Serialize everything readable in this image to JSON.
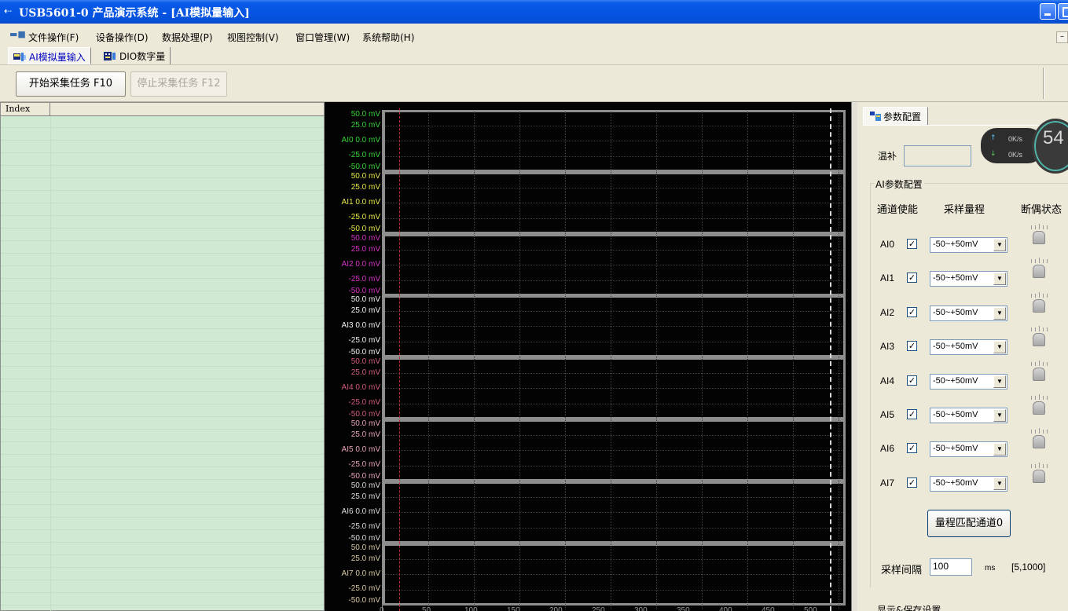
{
  "window": {
    "title": "USB5601-0 产品演示系统 - [AI模拟量输入]"
  },
  "menu": [
    "文件操作(F)",
    "设备操作(D)",
    "数据处理(P)",
    "视图控制(V)",
    "窗口管理(W)",
    "系统帮助(H)"
  ],
  "tabs": [
    {
      "label": "AI模拟量输入",
      "active": true
    },
    {
      "label": "DIO数字量",
      "active": false
    }
  ],
  "toolbar": {
    "start_label": "开始采集任务 F10",
    "stop_label": "停止采集任务 F12"
  },
  "list": {
    "header_index": "Index"
  },
  "scope": {
    "channels": [
      {
        "name": "AI0",
        "color": "#37d337",
        "top": "50.0 mV",
        "upper": "25.0 mV",
        "mid": "AI0  0.0 mV",
        "lower": "-25.0 mV",
        "bottom": "-50.0 mV"
      },
      {
        "name": "AI1",
        "color": "#e8e84a",
        "top": "50.0 mV",
        "upper": "25.0 mV",
        "mid": "AI1  0.0 mV",
        "lower": "-25.0 mV",
        "bottom": "-50.0 mV"
      },
      {
        "name": "AI2",
        "color": "#d633c8",
        "top": "50.0 mV",
        "upper": "25.0 mV",
        "mid": "AI2  0.0 mV",
        "lower": "-25.0 mV",
        "bottom": "-50.0 mV"
      },
      {
        "name": "AI3",
        "color": "#f2f2f2",
        "top": "50.0 mV",
        "upper": "25.0 mV",
        "mid": "AI3  0.0 mV",
        "lower": "-25.0 mV",
        "bottom": "-50.0 mV"
      },
      {
        "name": "AI4",
        "color": "#d25b7a",
        "top": "50.0 mV",
        "upper": "25.0 mV",
        "mid": "AI4  0.0 mV",
        "lower": "-25.0 mV",
        "bottom": "-50.0 mV"
      },
      {
        "name": "AI5",
        "color": "#e8a3b6",
        "top": "50.0 mV",
        "upper": "25.0 mV",
        "mid": "AI5  0.0 mV",
        "lower": "-25.0 mV",
        "bottom": "-50.0 mV"
      },
      {
        "name": "AI6",
        "color": "#dcdcdc",
        "top": "50.0 mV",
        "upper": "25.0 mV",
        "mid": "AI6  0.0 mV",
        "lower": "-25.0 mV",
        "bottom": "-50.0 mV"
      },
      {
        "name": "AI7",
        "color": "#d9c9a3",
        "top": "50.0 mV",
        "upper": "25.0 mV",
        "mid": "AI7  0.0 mV",
        "lower": "-25.0 mV",
        "bottom": "-50.0 mV"
      }
    ],
    "x_ticks": [
      "0",
      "50",
      "100",
      "150",
      "200",
      "250",
      "300",
      "350",
      "400",
      "450",
      "500"
    ]
  },
  "params": {
    "tab_label": "参数配置",
    "temp_label": "温补",
    "temp_value": "",
    "net_up": "0K/s",
    "net_down": "0K/s",
    "cpu": "54",
    "group_title": "AI参数配置",
    "col_enable": "通道使能",
    "col_range": "采样量程",
    "col_status": "断偶状态",
    "rows": [
      {
        "channel": "AI0",
        "enabled": true,
        "range": "-50~+50mV"
      },
      {
        "channel": "AI1",
        "enabled": true,
        "range": "-50~+50mV"
      },
      {
        "channel": "AI2",
        "enabled": true,
        "range": "-50~+50mV"
      },
      {
        "channel": "AI3",
        "enabled": true,
        "range": "-50~+50mV"
      },
      {
        "channel": "AI4",
        "enabled": true,
        "range": "-50~+50mV"
      },
      {
        "channel": "AI5",
        "enabled": true,
        "range": "-50~+50mV"
      },
      {
        "channel": "AI6",
        "enabled": true,
        "range": "-50~+50mV"
      },
      {
        "channel": "AI7",
        "enabled": true,
        "range": "-50~+50mV"
      }
    ],
    "match_button": "量程匹配通道0",
    "interval_label": "采样间隔",
    "interval_value": "100",
    "interval_unit": "ms",
    "interval_range": "[5,1000]",
    "display_group_title": "显示&保存设置"
  }
}
